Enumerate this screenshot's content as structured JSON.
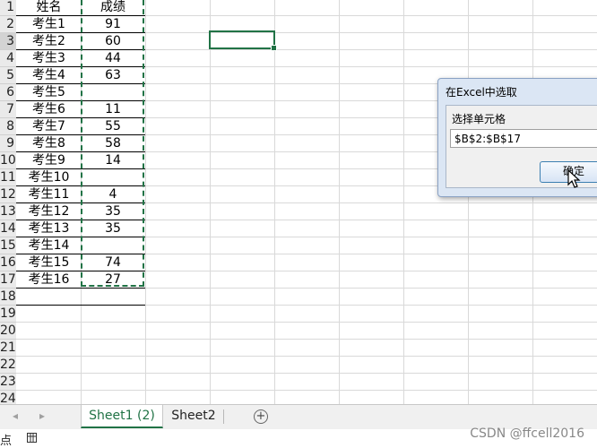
{
  "sheet": {
    "header_row": {
      "col_a": "姓名",
      "col_b": "成绩"
    },
    "rows": [
      {
        "num": "2",
        "name": "考生1",
        "score": "91"
      },
      {
        "num": "3",
        "name": "考生2",
        "score": "60"
      },
      {
        "num": "4",
        "name": "考生3",
        "score": "44"
      },
      {
        "num": "5",
        "name": "考生4",
        "score": "63"
      },
      {
        "num": "6",
        "name": "考生5",
        "score": ""
      },
      {
        "num": "7",
        "name": "考生6",
        "score": "11"
      },
      {
        "num": "8",
        "name": "考生7",
        "score": "55"
      },
      {
        "num": "9",
        "name": "考生8",
        "score": "58"
      },
      {
        "num": "10",
        "name": "考生9",
        "score": "14"
      },
      {
        "num": "11",
        "name": "考生10",
        "score": ""
      },
      {
        "num": "12",
        "name": "考生11",
        "score": "4"
      },
      {
        "num": "13",
        "name": "考生12",
        "score": "35"
      },
      {
        "num": "14",
        "name": "考生13",
        "score": "35"
      },
      {
        "num": "15",
        "name": "考生14",
        "score": ""
      },
      {
        "num": "16",
        "name": "考生15",
        "score": "74"
      },
      {
        "num": "17",
        "name": "考生16",
        "score": "27"
      }
    ],
    "empty_row_nums": [
      "1",
      "18",
      "19",
      "20",
      "21",
      "22",
      "23",
      "24"
    ]
  },
  "dialog": {
    "title": "在Excel中选取",
    "label": "选择单元格",
    "range_value": "$B$2:$B$17",
    "ok_label": "确定"
  },
  "tabs": {
    "active": "Sheet1 (2)",
    "other": "Sheet2",
    "add_symbol": "+",
    "nav_prev": "◂",
    "nav_next": "▸"
  },
  "status": {
    "text": "点"
  },
  "watermark": "CSDN @ffcell2016",
  "colors": {
    "accent": "#217346",
    "dialog_bg": "#dbe6f4"
  }
}
